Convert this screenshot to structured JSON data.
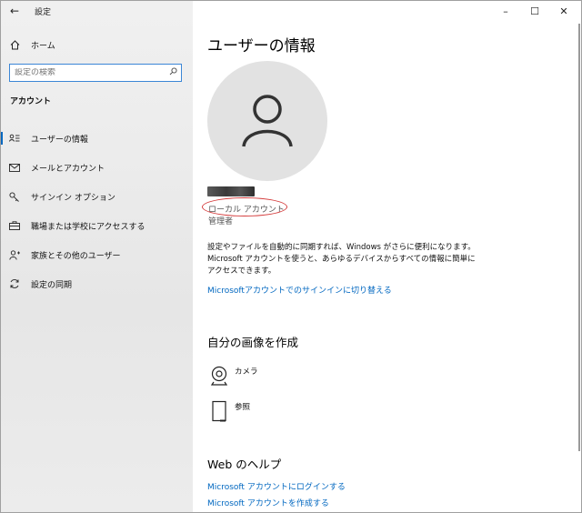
{
  "window": {
    "app_title": "設定",
    "back_icon": "back-arrow-icon",
    "minimize_glyph": "–",
    "maximize_glyph": "☐",
    "close_glyph": "✕"
  },
  "sidebar": {
    "home_label": "ホーム",
    "search_placeholder": "設定の検索",
    "section_heading": "アカウント",
    "items": [
      {
        "label": "ユーザーの情報",
        "icon": "user-info-icon",
        "active": true
      },
      {
        "label": "メールとアカウント",
        "icon": "mail-icon",
        "active": false
      },
      {
        "label": "サインイン オプション",
        "icon": "key-icon",
        "active": false
      },
      {
        "label": "職場または学校にアクセスする",
        "icon": "briefcase-icon",
        "active": false
      },
      {
        "label": "家族とその他のユーザー",
        "icon": "person-add-icon",
        "active": false
      },
      {
        "label": "設定の同期",
        "icon": "sync-icon",
        "active": false
      }
    ]
  },
  "main": {
    "title": "ユーザーの情報",
    "account_type": "ローカル アカウント",
    "role": "管理者",
    "description": "設定やファイルを自動的に同期すれば、Windows がさらに便利になります。Microsoft アカウントを使うと、あらゆるデバイスからすべての情報に簡単にアクセスできます。",
    "switch_link": "Microsoftアカウントでのサインインに切り替える",
    "create_picture_heading": "自分の画像を作成",
    "camera_label": "カメラ",
    "browse_label": "参照",
    "help_heading": "Web のヘルプ",
    "help_links": [
      "Microsoft アカウントにログインする",
      "Microsoft アカウントを作成する"
    ]
  },
  "colors": {
    "accent": "#0067c0",
    "highlight_ellipse": "#d43a3a",
    "avatar_bg": "#e2e2e2"
  }
}
